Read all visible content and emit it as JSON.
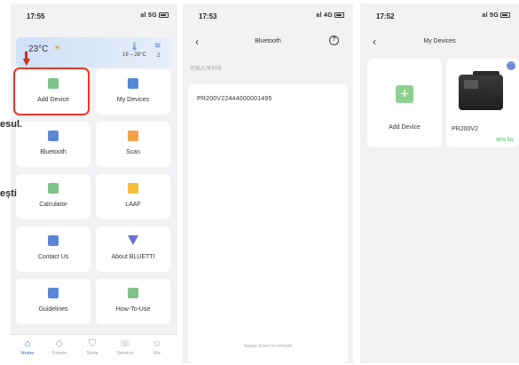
{
  "left_fragments": [
    "esul.",
    "ești"
  ],
  "screen1": {
    "status": {
      "time": "17:55",
      "signal": "al 5G"
    },
    "weather": {
      "temp": "23°C",
      "range": "19 – 28°C",
      "wind": "2"
    },
    "tiles": [
      {
        "label": "Add Device",
        "icon": "add-device-icon",
        "color": "#7fc28a"
      },
      {
        "label": "My Devices",
        "icon": "my-devices-icon",
        "color": "#5a86d6"
      },
      {
        "label": "Bluetooth",
        "icon": "bluetooth-icon",
        "color": "#5a86d6"
      },
      {
        "label": "Scan",
        "icon": "scan-icon",
        "color": "#f2a14a"
      },
      {
        "label": "Calculator",
        "icon": "calculator-icon",
        "color": "#7fc28a"
      },
      {
        "label": "LAAF",
        "icon": "laaf-icon",
        "color": "#f3bd3a"
      },
      {
        "label": "Contact Us",
        "icon": "contact-icon",
        "color": "#5a86d6"
      },
      {
        "label": "About BLUETTI",
        "icon": "about-icon",
        "color": "#6d6fd6"
      },
      {
        "label": "Guidelines",
        "icon": "guidelines-icon",
        "color": "#5a86d6"
      },
      {
        "label": "How-To-Use",
        "icon": "how-to-use-icon",
        "color": "#7fc28a"
      }
    ],
    "tabs": [
      {
        "label": "Home",
        "glyph": "⌂",
        "active": true
      },
      {
        "label": "Forum",
        "glyph": "◇",
        "active": false
      },
      {
        "label": "Store",
        "glyph": "⛉",
        "active": false
      },
      {
        "label": "Service",
        "glyph": "☏",
        "active": false
      },
      {
        "label": "Me",
        "glyph": "☺",
        "active": false
      }
    ]
  },
  "screen2": {
    "status": {
      "time": "17:53",
      "signal": "al 4G"
    },
    "title": "Bluetooth",
    "hint": "可输入序列号",
    "device_serial": "PR200V224440000014​95",
    "refresh_hint": "Swipe down to refresh"
  },
  "screen3": {
    "status": {
      "time": "17:52",
      "signal": "al 5G"
    },
    "title": "My Devices",
    "add_label": "Add Device",
    "device_name": "PR200V2",
    "device_percent": "95% 5G"
  },
  "colors": {
    "accent": "#2f5fc4",
    "highlight": "#e23a2a",
    "success": "#3fae55"
  }
}
